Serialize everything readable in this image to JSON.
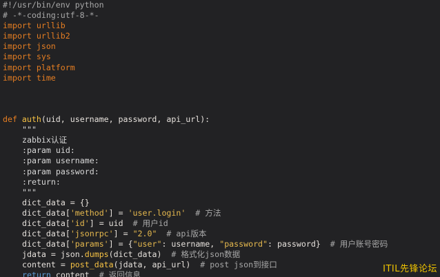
{
  "code": {
    "l1": "#!/usr/bin/env python",
    "l2": "# -*-coding:utf-8-*-",
    "imports": [
      {
        "kw": "import",
        "mod": " urllib"
      },
      {
        "kw": "import",
        "mod": " urllib2"
      },
      {
        "kw": "import",
        "mod": " json"
      },
      {
        "kw": "import",
        "mod": " sys"
      },
      {
        "kw": "import",
        "mod": " platform"
      },
      {
        "kw": "import",
        "mod": " time"
      }
    ],
    "def_kw": "def",
    "def_name": " auth",
    "def_args": "(uid, username, password, api_url):",
    "doc_open": "\"\"\"",
    "doc_1": "zabbix认证",
    "doc_2": ":param uid:",
    "doc_3": ":param username:",
    "doc_4": ":param password:",
    "doc_5": ":return:",
    "doc_close": "\"\"\"",
    "s1_a": "dict_data = {}",
    "s2_a": "dict_data[",
    "s2_key": "'method'",
    "s2_b": "] = ",
    "s2_val": "'user.login'",
    "s2_c": "  # 方法",
    "s3_a": "dict_data[",
    "s3_key": "'id'",
    "s3_b": "] = uid  ",
    "s3_c": "# 用户id",
    "s4_a": "dict_data[",
    "s4_key": "'jsonrpc'",
    "s4_b": "] = ",
    "s4_val": "\"2.0\"",
    "s4_c": "  # api版本",
    "s5_a": "dict_data[",
    "s5_key": "'params'",
    "s5_b": "] = {",
    "s5_k1": "\"user\"",
    "s5_m1": ": username, ",
    "s5_k2": "\"password\"",
    "s5_m2": ": password}",
    "s5_c": "  # 用户账号密码",
    "s6_a": "jdata = json.",
    "s6_fn": "dumps",
    "s6_b": "(dict_data)",
    "s6_c": "  # 格式化json数据",
    "s7_a": "content = ",
    "s7_fn": "post_data",
    "s7_b": "(jdata, api_url)",
    "s7_c": "  # post json到接口",
    "s8_kw": "return",
    "s8_a": " content",
    "s8_c": "  # 返回信息"
  },
  "watermark": "ITIL先锋论坛",
  "colors": {
    "background": "#222224",
    "keyword": "#e67e22",
    "return_keyword": "#5b9bd5",
    "function": "#f6c244",
    "string": "#e6b94e",
    "comment": "#a8a8a8",
    "watermark": "#f0c400"
  }
}
